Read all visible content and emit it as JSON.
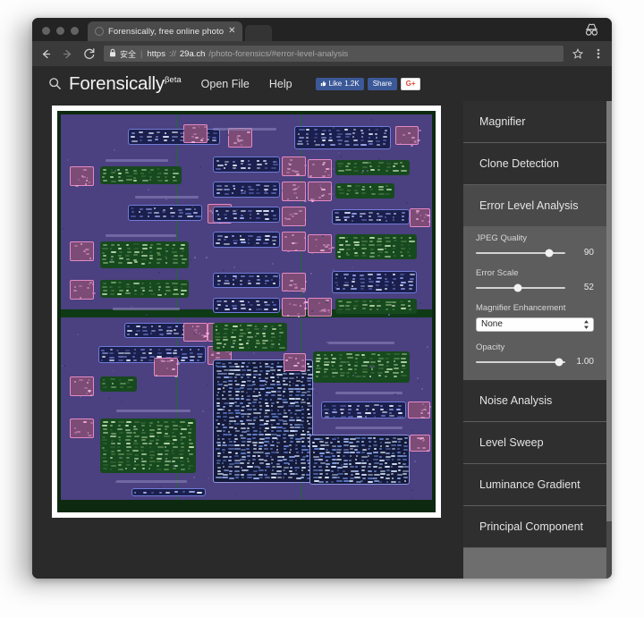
{
  "browser": {
    "tab": {
      "title": "Forensically, free online photo",
      "close_label": "✕",
      "favicon_name": "page-favicon"
    },
    "window_controls": [
      "close",
      "minimize",
      "maximize"
    ],
    "incognito_label": "incognito-mode",
    "omnibox": {
      "back_label": "←",
      "forward_label": "→",
      "reload_label": "⟳",
      "secure_label": "安全",
      "separator": "|",
      "scheme": "https",
      "scheme_sep": "://",
      "host": "29a.ch",
      "path": "/photo-forensics/#error-level-analysis",
      "bookmark_label": "☆",
      "menu_label": "⋮"
    }
  },
  "app": {
    "search_icon": "search-icon",
    "brand": "Forensically",
    "brand_sup": "βeta",
    "nav": [
      {
        "label": "Open File",
        "name": "open-file"
      },
      {
        "label": "Help",
        "name": "help"
      }
    ],
    "social": {
      "like_label": "Like",
      "like_count": "1.2K",
      "share_label": "Share",
      "gplus_label": "G+"
    }
  },
  "sidebar": {
    "panels": [
      {
        "name": "magnifier",
        "label": "Magnifier",
        "active": false
      },
      {
        "name": "clone-detection",
        "label": "Clone Detection",
        "active": false
      },
      {
        "name": "error-level-analysis",
        "label": "Error Level Analysis",
        "active": true
      },
      {
        "name": "noise-analysis",
        "label": "Noise Analysis",
        "active": false
      },
      {
        "name": "level-sweep",
        "label": "Level Sweep",
        "active": false
      },
      {
        "name": "luminance-gradient",
        "label": "Luminance Gradient",
        "active": false
      },
      {
        "name": "principal-component",
        "label": "Principal Component",
        "active": false
      }
    ],
    "ela_controls": {
      "jpeg_quality": {
        "label": "JPEG Quality",
        "value": "90",
        "percent": 82
      },
      "error_scale": {
        "label": "Error Scale",
        "value": "52",
        "percent": 47
      },
      "magnifier_enhancement": {
        "label": "Magnifier Enhancement",
        "value": "None",
        "options": [
          "None"
        ],
        "up_arrow": "▲",
        "down_arrow": "▼"
      },
      "opacity": {
        "label": "Opacity",
        "value": "1.00",
        "percent": 93
      }
    }
  },
  "colors": {
    "chrome_dark": "#2b2b2b",
    "chrome_bar": "#3a3a3a",
    "page_bg": "#2a2a2a",
    "sidebar_bg": "#6e6e6e",
    "panel_head": "#2f2f2f",
    "panel_active": "#4a4a4a",
    "panel_body": "#5d5d5d",
    "facebook_blue": "#3b5998",
    "gplus_red": "#dd4b39",
    "ela_background": "#4b4080",
    "ela_green_bubble": "#17491f",
    "ela_blue_bubble": "#1b1f4d",
    "ela_avatar_edge": "#e48ac4",
    "ela_frame": "#ffffff"
  }
}
